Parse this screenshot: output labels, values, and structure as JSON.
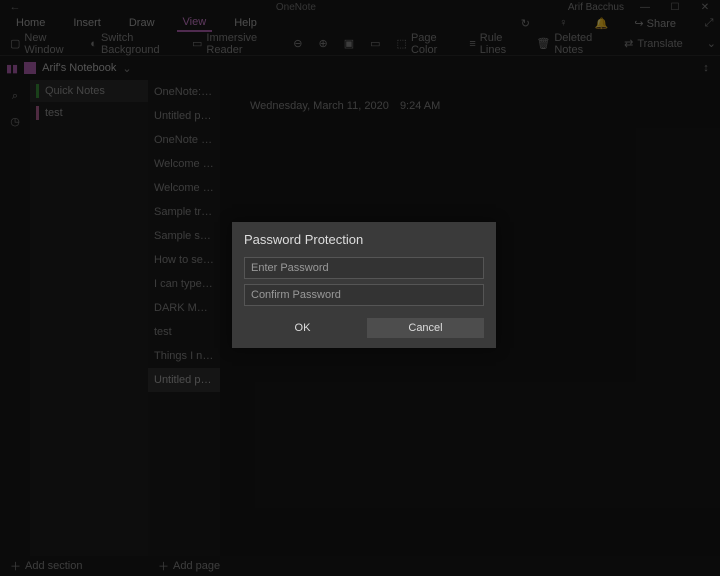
{
  "titlebar": {
    "app_name": "OneNote",
    "user": "Arif Bacchus"
  },
  "menu": {
    "items": [
      "Home",
      "Insert",
      "Draw",
      "View",
      "Help"
    ],
    "active_index": 3,
    "share": "Share"
  },
  "ribbon": {
    "new_window": "New Window",
    "switch_background": "Switch Background",
    "immersive_reader": "Immersive Reader",
    "page_color": "Page Color",
    "rule_lines": "Rule Lines",
    "deleted_notes": "Deleted Notes",
    "translate": "Translate"
  },
  "notebook": {
    "name": "Arif's Notebook"
  },
  "sections": [
    {
      "label": "Quick Notes",
      "color": "#3a8f3a",
      "selected": true
    },
    {
      "label": "test",
      "color": "#b06090",
      "selected": false
    }
  ],
  "pages": [
    "OneNote: on…",
    "Untitled page",
    "OneNote Bas…",
    "Welcome to…",
    "Welcome to …",
    "Sample trip p…",
    "Sample shop…",
    "How to set u…",
    "I can type on…",
    "DARK MODE…",
    "test",
    "Things I need…",
    "Untitled page"
  ],
  "selected_page_index": 12,
  "content": {
    "date": "Wednesday, March 11, 2020",
    "time": "9:24 AM"
  },
  "footer": {
    "add_section": "Add section",
    "add_page": "Add page"
  },
  "dialog": {
    "title": "Password Protection",
    "enter_placeholder": "Enter Password",
    "confirm_placeholder": "Confirm Password",
    "ok": "OK",
    "cancel": "Cancel"
  }
}
